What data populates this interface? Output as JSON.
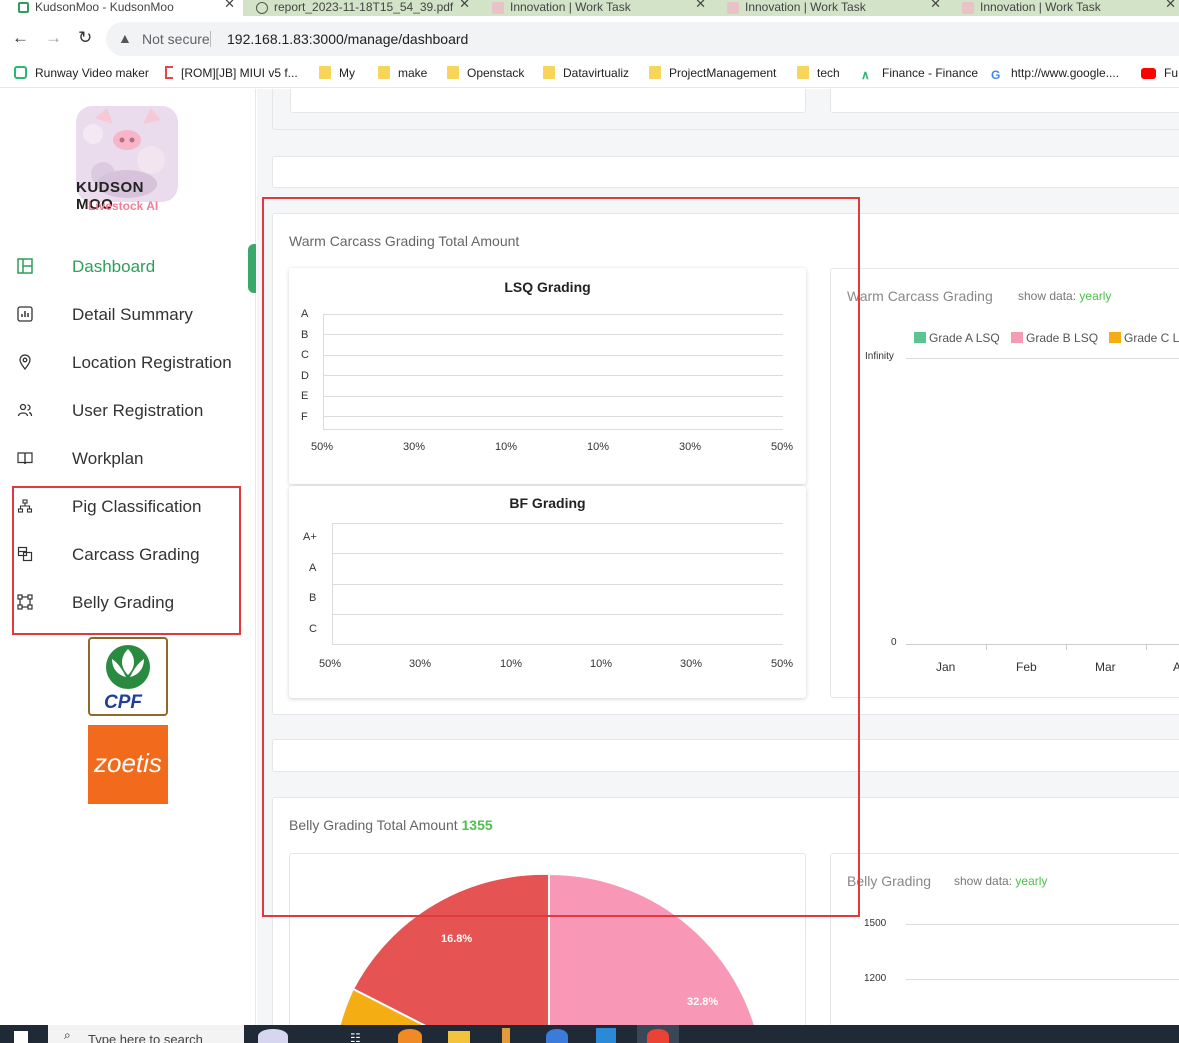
{
  "browser": {
    "tabs": [
      {
        "title": "KudsonMoo - KudsonMoo",
        "active": true
      },
      {
        "title": "report_2023-11-18T15_54_39.pdf",
        "active": false
      },
      {
        "title": "Innovation | Work Task",
        "active": false
      },
      {
        "title": "Innovation | Work Task",
        "active": false
      },
      {
        "title": "Innovation | Work Task",
        "active": false
      }
    ],
    "security_label": "Not secure",
    "url": "192.168.1.83:3000/manage/dashboard",
    "bookmarks": [
      {
        "label": "Runway Video maker",
        "icon": "runway-icon"
      },
      {
        "label": "[ROM][JB] MIUI v5 f...",
        "icon": "bracket-icon"
      },
      {
        "label": "My",
        "icon": "folder-icon"
      },
      {
        "label": "make",
        "icon": "folder-icon"
      },
      {
        "label": "Openstack",
        "icon": "folder-icon"
      },
      {
        "label": "Datavirtualiz",
        "icon": "folder-icon"
      },
      {
        "label": "ProjectManagement",
        "icon": "folder-icon"
      },
      {
        "label": "tech",
        "icon": "folder-icon"
      },
      {
        "label": "Finance - Finance",
        "icon": "finance-icon"
      },
      {
        "label": "http://www.google....",
        "icon": "google-icon"
      },
      {
        "label": "Fu",
        "icon": "youtube-icon"
      }
    ]
  },
  "sidebar": {
    "brand": "KUDSON MOO",
    "tagline": "Livestock AI",
    "items": [
      {
        "label": "Dashboard",
        "icon": "dashboard-icon",
        "active": true
      },
      {
        "label": "Detail Summary",
        "icon": "bar-chart-icon"
      },
      {
        "label": "Location Registration",
        "icon": "location-pin-icon"
      },
      {
        "label": "User Registration",
        "icon": "users-icon"
      },
      {
        "label": "Workplan",
        "icon": "book-icon"
      },
      {
        "label": "Pig Classification",
        "icon": "hierarchy-icon"
      },
      {
        "label": "Carcass Grading",
        "icon": "grid-icon"
      },
      {
        "label": "Belly Grading",
        "icon": "vector-square-icon"
      }
    ],
    "partner_logos": [
      "CPF",
      "zoetis"
    ]
  },
  "main": {
    "warm_carcass": {
      "title": "Warm Carcass Grading Total Amount",
      "lsq_title": "LSQ Grading",
      "lsq_rows": [
        "A",
        "B",
        "C",
        "D",
        "E",
        "F"
      ],
      "lsq_ticks": [
        "50%",
        "30%",
        "10%",
        "10%",
        "30%",
        "50%"
      ],
      "bf_title": "BF Grading",
      "bf_rows": [
        "A+",
        "A",
        "B",
        "C"
      ],
      "bf_ticks": [
        "50%",
        "30%",
        "10%",
        "10%",
        "30%",
        "50%"
      ],
      "right_title": "Warm Carcass Grading",
      "show_data_label": "show data:",
      "show_data_value": "yearly",
      "legend": [
        {
          "label": "Grade A LSQ",
          "color": "#5cc48f"
        },
        {
          "label": "Grade B LSQ",
          "color": "#f59bb4"
        },
        {
          "label": "Grade C L",
          "color": "#f5ad14"
        }
      ],
      "y_top": "Infinity",
      "y_bottom": "0",
      "months": [
        "Jan",
        "Feb",
        "Mar",
        "A"
      ]
    },
    "belly": {
      "title": "Belly Grading Total Amount",
      "total": "1355",
      "pie_labels": [
        "16.8%",
        "32.8%"
      ],
      "right_title": "Belly Grading",
      "show_data_label": "show data:",
      "show_data_value": "yearly",
      "y_ticks": [
        "1500",
        "1200"
      ]
    }
  },
  "taskbar": {
    "search_placeholder": "Type here to search"
  }
}
